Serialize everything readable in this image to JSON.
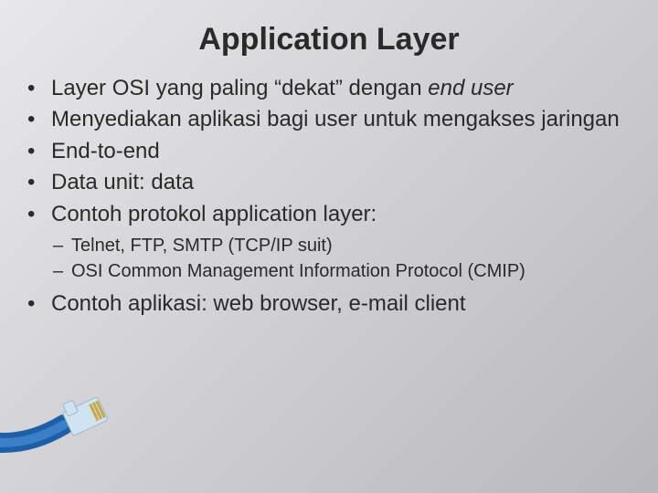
{
  "title": "Application Layer",
  "bullets": {
    "b1a": "Layer OSI yang paling “dekat” dengan ",
    "b1b": "end user",
    "b2": "Menyediakan aplikasi bagi user untuk mengakses jaringan",
    "b3": "End-to-end",
    "b4": "Data unit: data",
    "b5": "Contoh protokol application layer:",
    "b5s1": "Telnet, FTP, SMTP (TCP/IP suit)",
    "b5s2": "OSI Common Management Information Protocol (CMIP)",
    "b6": "Contoh aplikasi: web browser, e-mail client"
  }
}
